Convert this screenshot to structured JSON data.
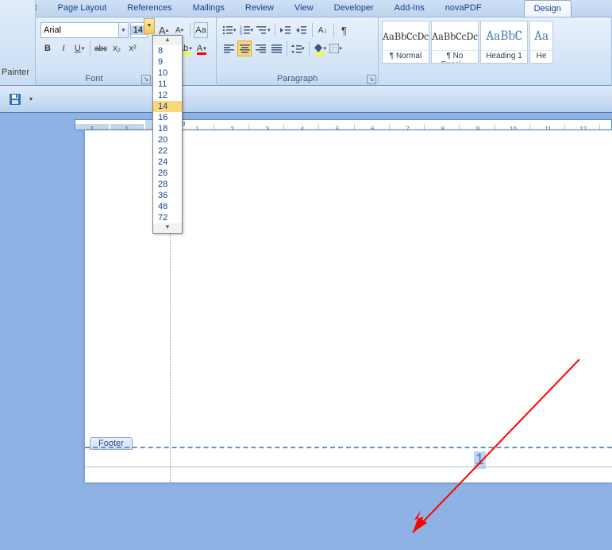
{
  "tabs": [
    "Insert",
    "Page Layout",
    "References",
    "Mailings",
    "Review",
    "View",
    "Developer",
    "Add-Ins",
    "novaPDF",
    "Design"
  ],
  "sidebar": {
    "painter": "Painter"
  },
  "font": {
    "name": "Arial",
    "size": "14",
    "size_options": [
      "8",
      "9",
      "10",
      "11",
      "12",
      "14",
      "16",
      "18",
      "20",
      "22",
      "24",
      "26",
      "28",
      "36",
      "48",
      "72"
    ],
    "selected_size": "14",
    "group_label": "Font",
    "bold": "B",
    "italic": "I",
    "underline": "U",
    "strike": "abc",
    "sub": "x₂",
    "sup": "x²",
    "grow": "A",
    "shrink": "A",
    "clear": "Aa",
    "case": "A",
    "highlight": "ab",
    "color": "A"
  },
  "paragraph": {
    "group_label": "Paragraph"
  },
  "styles": [
    {
      "preview": "AaBbCcDc",
      "name": "¶ Normal",
      "accent": false
    },
    {
      "preview": "AaBbCcDc",
      "name": "¶ No Spaci…",
      "accent": false
    },
    {
      "preview": "AaBbC",
      "name": "Heading 1",
      "accent": true
    },
    {
      "preview": "Aa",
      "name": "He",
      "accent": true
    }
  ],
  "ruler": {
    "marks_left": [
      "2",
      "1"
    ],
    "marks_right": [
      "1",
      "2",
      "3",
      "4",
      "5",
      "6",
      "7",
      "8",
      "9",
      "10",
      "11",
      "12"
    ]
  },
  "footer": {
    "tag": "Footer",
    "page_number": "1"
  },
  "qat": {
    "save_icon": "💾"
  }
}
